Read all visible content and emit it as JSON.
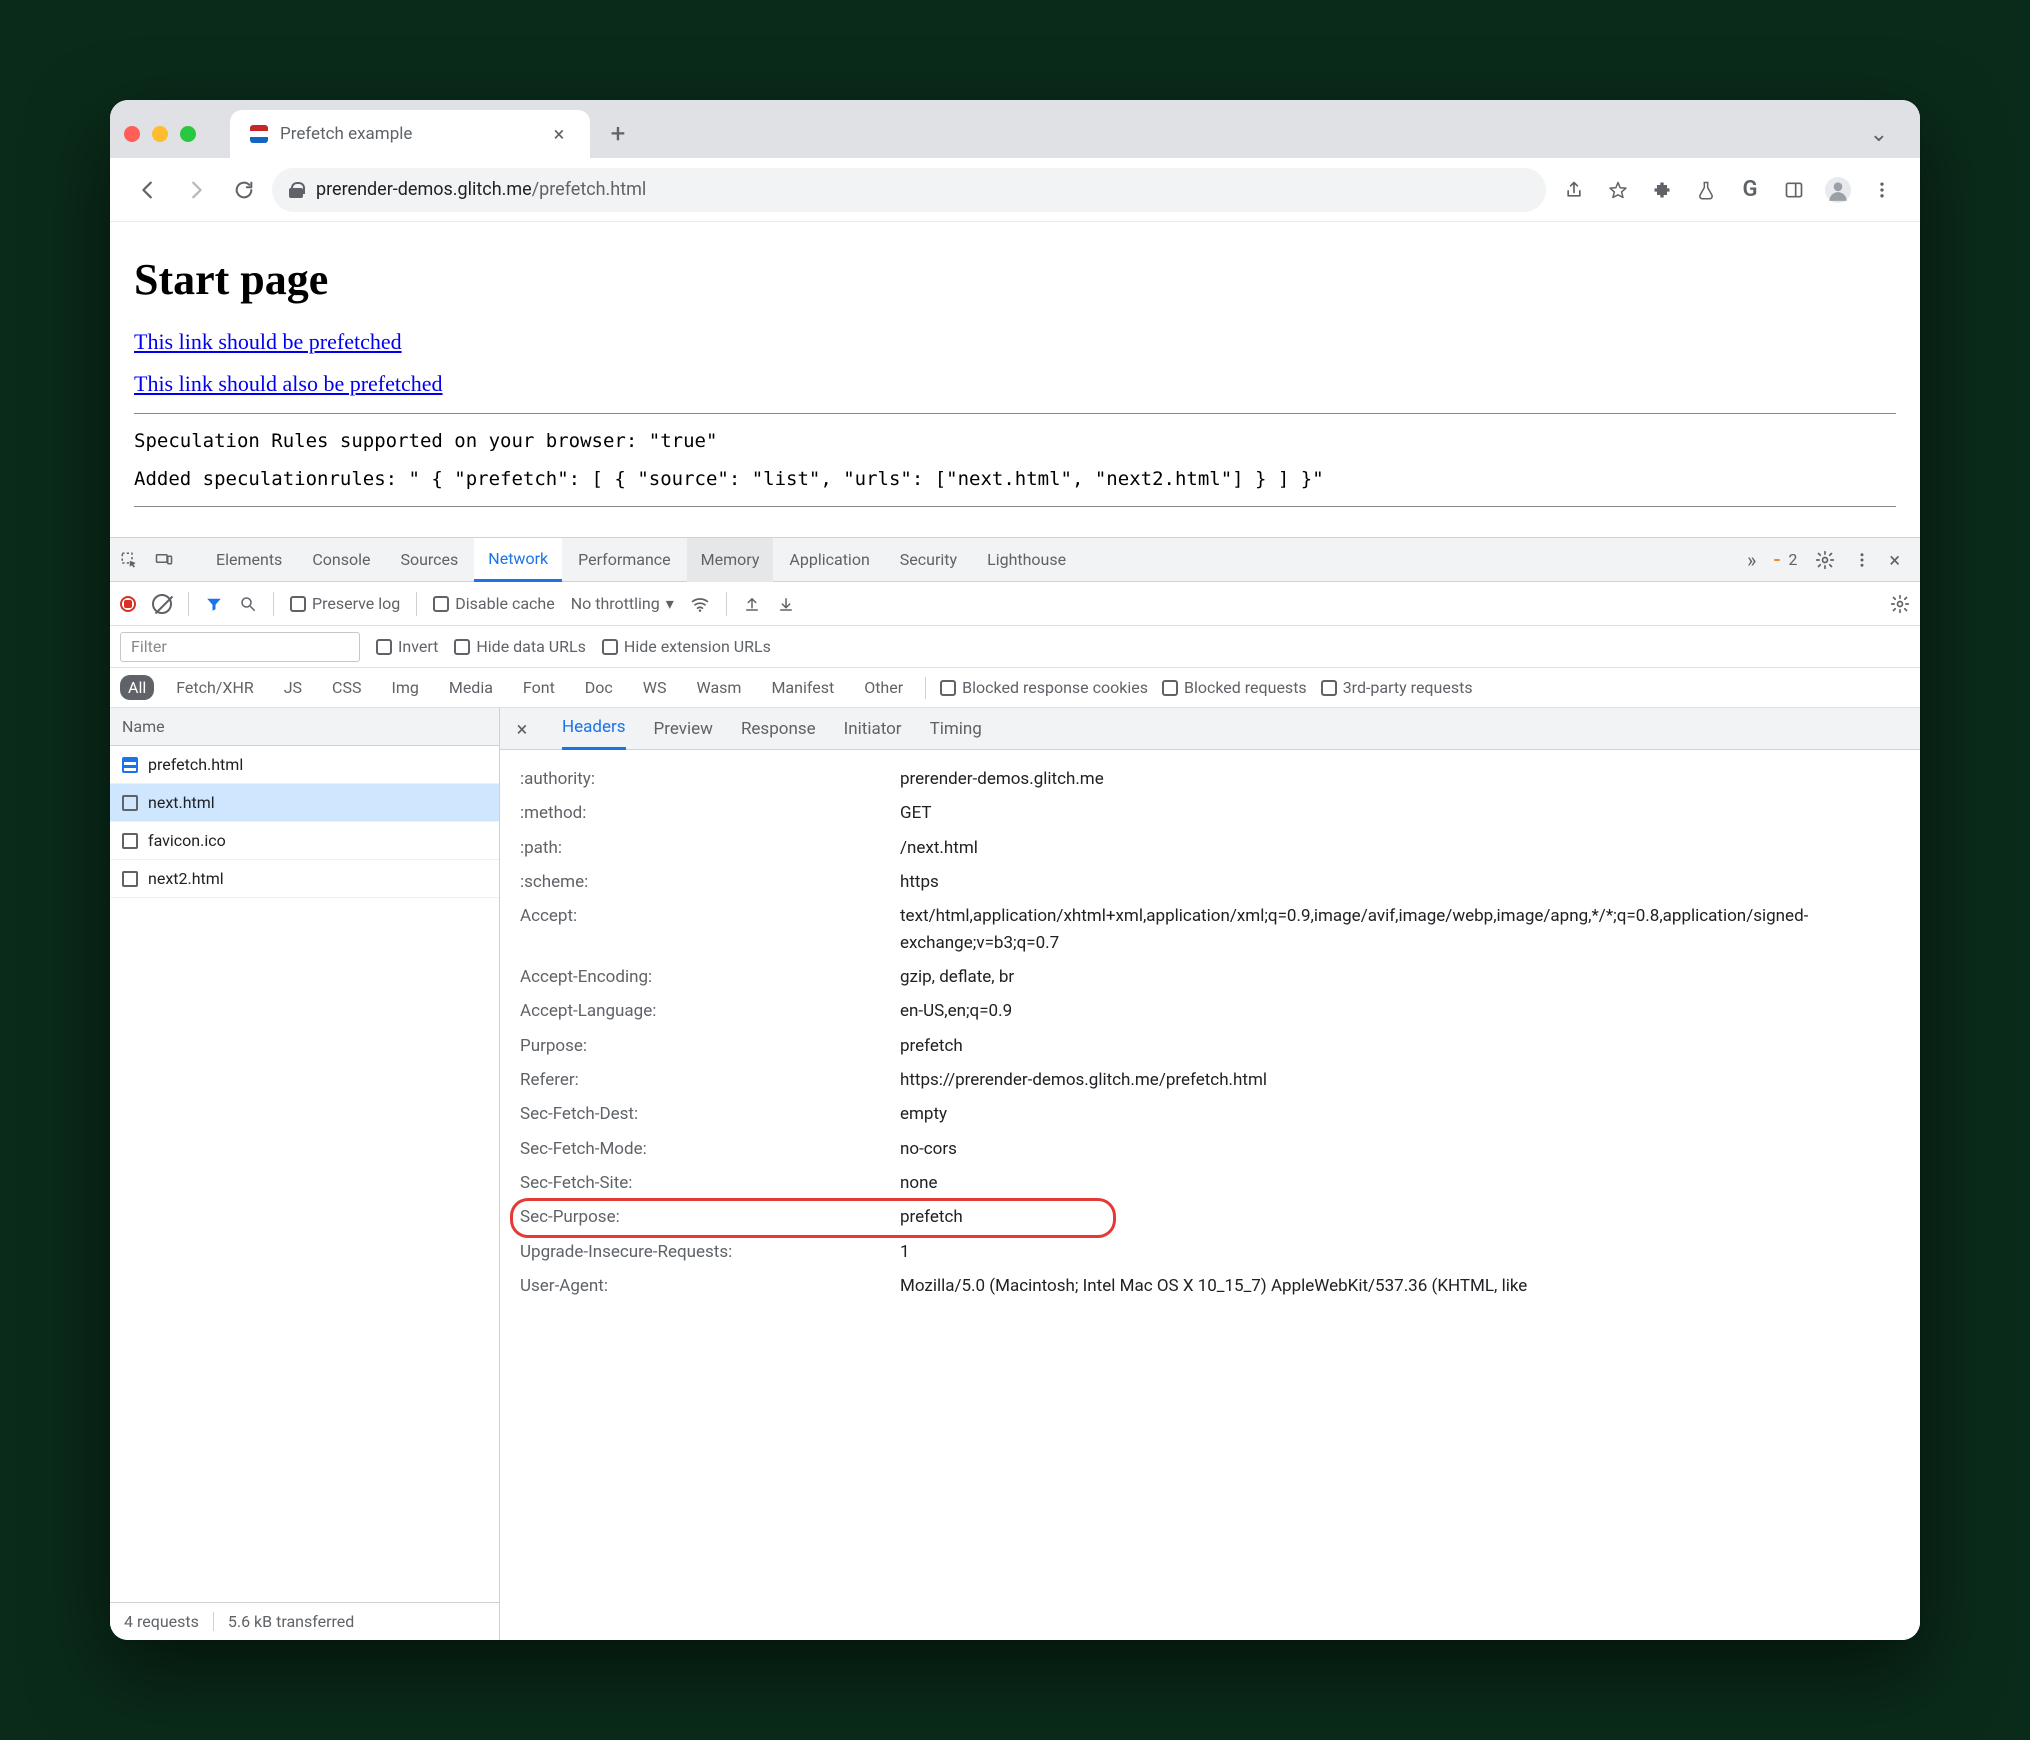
{
  "tab": {
    "title": "Prefetch example"
  },
  "url": {
    "host": "prerender-demos.glitch.me",
    "path": "/prefetch.html"
  },
  "page": {
    "h1": "Start page",
    "link1": "This link should be prefetched",
    "link2": "This link should also be prefetched",
    "line1": "Speculation Rules supported on your browser: \"true\"",
    "line2": "Added speculationrules: \" { \"prefetch\": [ { \"source\": \"list\", \"urls\": [\"next.html\", \"next2.html\"] } ] }\""
  },
  "devtools": {
    "panels": [
      "Elements",
      "Console",
      "Sources",
      "Network",
      "Performance",
      "Memory",
      "Application",
      "Security",
      "Lighthouse"
    ],
    "active_panel": "Network",
    "badge_count": "2",
    "filter1": {
      "preserve": "Preserve log",
      "disable": "Disable cache",
      "throttling": "No throttling"
    },
    "filter2": {
      "filter_placeholder": "Filter",
      "invert": "Invert",
      "hide_data": "Hide data URLs",
      "hide_ext": "Hide extension URLs"
    },
    "types": [
      "All",
      "Fetch/XHR",
      "JS",
      "CSS",
      "Img",
      "Media",
      "Font",
      "Doc",
      "WS",
      "Wasm",
      "Manifest",
      "Other"
    ],
    "type_opts": {
      "blocked_cookies": "Blocked response cookies",
      "blocked_req": "Blocked requests",
      "third": "3rd-party requests"
    },
    "name_header": "Name",
    "requests": [
      {
        "name": "prefetch.html",
        "icon": "doc"
      },
      {
        "name": "next.html",
        "icon": "other",
        "selected": true
      },
      {
        "name": "favicon.ico",
        "icon": "other"
      },
      {
        "name": "next2.html",
        "icon": "other"
      }
    ],
    "footer": {
      "count": "4 requests",
      "size": "5.6 kB transferred"
    },
    "detail_tabs": [
      "Headers",
      "Preview",
      "Response",
      "Initiator",
      "Timing"
    ],
    "detail_active": "Headers",
    "headers": [
      {
        "k": ":authority:",
        "v": "prerender-demos.glitch.me"
      },
      {
        "k": ":method:",
        "v": "GET"
      },
      {
        "k": ":path:",
        "v": "/next.html"
      },
      {
        "k": ":scheme:",
        "v": "https"
      },
      {
        "k": "Accept:",
        "v": "text/html,application/xhtml+xml,application/xml;q=0.9,image/avif,image/webp,image/apng,*/*;q=0.8,application/signed-exchange;v=b3;q=0.7"
      },
      {
        "k": "Accept-Encoding:",
        "v": "gzip, deflate, br"
      },
      {
        "k": "Accept-Language:",
        "v": "en-US,en;q=0.9"
      },
      {
        "k": "Purpose:",
        "v": "prefetch"
      },
      {
        "k": "Referer:",
        "v": "https://prerender-demos.glitch.me/prefetch.html"
      },
      {
        "k": "Sec-Fetch-Dest:",
        "v": "empty"
      },
      {
        "k": "Sec-Fetch-Mode:",
        "v": "no-cors"
      },
      {
        "k": "Sec-Fetch-Site:",
        "v": "none"
      },
      {
        "k": "Sec-Purpose:",
        "v": "prefetch",
        "hl": true
      },
      {
        "k": "Upgrade-Insecure-Requests:",
        "v": "1"
      },
      {
        "k": "User-Agent:",
        "v": "Mozilla/5.0 (Macintosh; Intel Mac OS X 10_15_7) AppleWebKit/537.36 (KHTML, like"
      }
    ]
  }
}
